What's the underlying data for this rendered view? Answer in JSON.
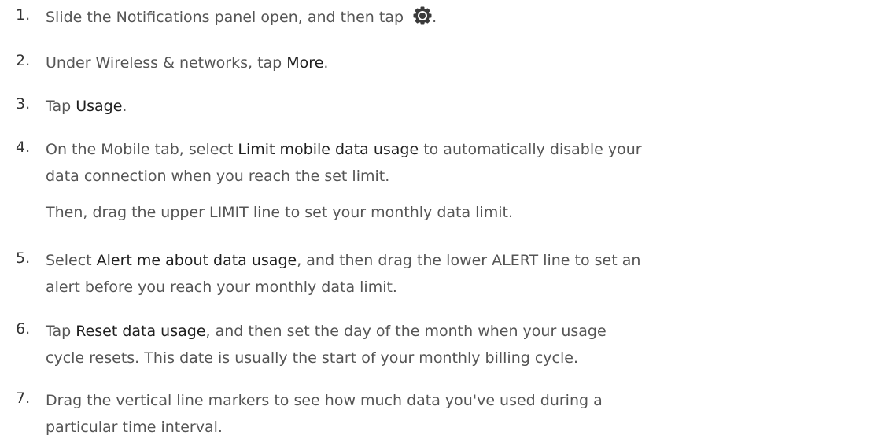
{
  "steps": [
    {
      "number": "1.",
      "lines": [
        {
          "segments": [
            {
              "text": "Slide the Notifications panel open, and then tap ",
              "emph": false
            },
            {
              "icon": "gear-icon"
            },
            {
              "text": ".",
              "emph": false
            }
          ]
        }
      ]
    },
    {
      "number": "2.",
      "lines": [
        {
          "segments": [
            {
              "text": "Under Wireless & networks, tap ",
              "emph": false
            },
            {
              "text": "More",
              "emph": true
            },
            {
              "text": ".",
              "emph": false
            }
          ]
        }
      ]
    },
    {
      "number": "3.",
      "lines": [
        {
          "segments": [
            {
              "text": "Tap ",
              "emph": false
            },
            {
              "text": "Usage",
              "emph": true
            },
            {
              "text": ".",
              "emph": false
            }
          ]
        }
      ]
    },
    {
      "number": "4.",
      "lines": [
        {
          "segments": [
            {
              "text": "On the Mobile tab, select ",
              "emph": false
            },
            {
              "text": "Limit mobile data usage",
              "emph": true
            },
            {
              "text": " to automatically disable your",
              "emph": false
            }
          ]
        },
        {
          "segments": [
            {
              "text": "data connection when you reach the set limit.",
              "emph": false
            }
          ]
        }
      ],
      "after": [
        {
          "segments": [
            {
              "text": "Then, drag the upper LIMIT line to set your monthly data limit.",
              "emph": false
            }
          ]
        }
      ]
    },
    {
      "number": "5.",
      "lines": [
        {
          "segments": [
            {
              "text": "Select ",
              "emph": false
            },
            {
              "text": "Alert me about data usage",
              "emph": true
            },
            {
              "text": ", and then drag the lower ALERT line to set an",
              "emph": false
            }
          ]
        },
        {
          "segments": [
            {
              "text": "alert before you reach your monthly data limit.",
              "emph": false
            }
          ]
        }
      ]
    },
    {
      "number": "6.",
      "lines": [
        {
          "segments": [
            {
              "text": "Tap ",
              "emph": false
            },
            {
              "text": "Reset data usage",
              "emph": true
            },
            {
              "text": ", and then set the day of the month when your usage",
              "emph": false
            }
          ]
        },
        {
          "segments": [
            {
              "text": "cycle resets. This date is usually the start of your monthly billing cycle.",
              "emph": false
            }
          ]
        }
      ]
    },
    {
      "number": "7.",
      "lines": [
        {
          "segments": [
            {
              "text": "Drag the vertical line markers to see how much data you've used during a",
              "emph": false
            }
          ]
        },
        {
          "segments": [
            {
              "text": "particular time interval.",
              "emph": false
            }
          ]
        }
      ]
    }
  ]
}
